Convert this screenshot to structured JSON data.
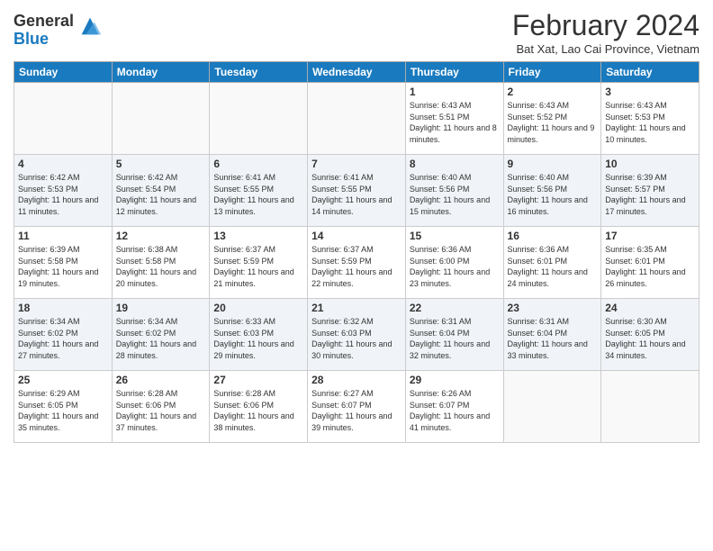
{
  "header": {
    "logo_general": "General",
    "logo_blue": "Blue",
    "title": "February 2024",
    "location": "Bat Xat, Lao Cai Province, Vietnam"
  },
  "days_of_week": [
    "Sunday",
    "Monday",
    "Tuesday",
    "Wednesday",
    "Thursday",
    "Friday",
    "Saturday"
  ],
  "weeks": [
    [
      {
        "day": "",
        "info": ""
      },
      {
        "day": "",
        "info": ""
      },
      {
        "day": "",
        "info": ""
      },
      {
        "day": "",
        "info": ""
      },
      {
        "day": "1",
        "info": "Sunrise: 6:43 AM\nSunset: 5:51 PM\nDaylight: 11 hours and 8 minutes."
      },
      {
        "day": "2",
        "info": "Sunrise: 6:43 AM\nSunset: 5:52 PM\nDaylight: 11 hours and 9 minutes."
      },
      {
        "day": "3",
        "info": "Sunrise: 6:43 AM\nSunset: 5:53 PM\nDaylight: 11 hours and 10 minutes."
      }
    ],
    [
      {
        "day": "4",
        "info": "Sunrise: 6:42 AM\nSunset: 5:53 PM\nDaylight: 11 hours and 11 minutes."
      },
      {
        "day": "5",
        "info": "Sunrise: 6:42 AM\nSunset: 5:54 PM\nDaylight: 11 hours and 12 minutes."
      },
      {
        "day": "6",
        "info": "Sunrise: 6:41 AM\nSunset: 5:55 PM\nDaylight: 11 hours and 13 minutes."
      },
      {
        "day": "7",
        "info": "Sunrise: 6:41 AM\nSunset: 5:55 PM\nDaylight: 11 hours and 14 minutes."
      },
      {
        "day": "8",
        "info": "Sunrise: 6:40 AM\nSunset: 5:56 PM\nDaylight: 11 hours and 15 minutes."
      },
      {
        "day": "9",
        "info": "Sunrise: 6:40 AM\nSunset: 5:56 PM\nDaylight: 11 hours and 16 minutes."
      },
      {
        "day": "10",
        "info": "Sunrise: 6:39 AM\nSunset: 5:57 PM\nDaylight: 11 hours and 17 minutes."
      }
    ],
    [
      {
        "day": "11",
        "info": "Sunrise: 6:39 AM\nSunset: 5:58 PM\nDaylight: 11 hours and 19 minutes."
      },
      {
        "day": "12",
        "info": "Sunrise: 6:38 AM\nSunset: 5:58 PM\nDaylight: 11 hours and 20 minutes."
      },
      {
        "day": "13",
        "info": "Sunrise: 6:37 AM\nSunset: 5:59 PM\nDaylight: 11 hours and 21 minutes."
      },
      {
        "day": "14",
        "info": "Sunrise: 6:37 AM\nSunset: 5:59 PM\nDaylight: 11 hours and 22 minutes."
      },
      {
        "day": "15",
        "info": "Sunrise: 6:36 AM\nSunset: 6:00 PM\nDaylight: 11 hours and 23 minutes."
      },
      {
        "day": "16",
        "info": "Sunrise: 6:36 AM\nSunset: 6:01 PM\nDaylight: 11 hours and 24 minutes."
      },
      {
        "day": "17",
        "info": "Sunrise: 6:35 AM\nSunset: 6:01 PM\nDaylight: 11 hours and 26 minutes."
      }
    ],
    [
      {
        "day": "18",
        "info": "Sunrise: 6:34 AM\nSunset: 6:02 PM\nDaylight: 11 hours and 27 minutes."
      },
      {
        "day": "19",
        "info": "Sunrise: 6:34 AM\nSunset: 6:02 PM\nDaylight: 11 hours and 28 minutes."
      },
      {
        "day": "20",
        "info": "Sunrise: 6:33 AM\nSunset: 6:03 PM\nDaylight: 11 hours and 29 minutes."
      },
      {
        "day": "21",
        "info": "Sunrise: 6:32 AM\nSunset: 6:03 PM\nDaylight: 11 hours and 30 minutes."
      },
      {
        "day": "22",
        "info": "Sunrise: 6:31 AM\nSunset: 6:04 PM\nDaylight: 11 hours and 32 minutes."
      },
      {
        "day": "23",
        "info": "Sunrise: 6:31 AM\nSunset: 6:04 PM\nDaylight: 11 hours and 33 minutes."
      },
      {
        "day": "24",
        "info": "Sunrise: 6:30 AM\nSunset: 6:05 PM\nDaylight: 11 hours and 34 minutes."
      }
    ],
    [
      {
        "day": "25",
        "info": "Sunrise: 6:29 AM\nSunset: 6:05 PM\nDaylight: 11 hours and 35 minutes."
      },
      {
        "day": "26",
        "info": "Sunrise: 6:28 AM\nSunset: 6:06 PM\nDaylight: 11 hours and 37 minutes."
      },
      {
        "day": "27",
        "info": "Sunrise: 6:28 AM\nSunset: 6:06 PM\nDaylight: 11 hours and 38 minutes."
      },
      {
        "day": "28",
        "info": "Sunrise: 6:27 AM\nSunset: 6:07 PM\nDaylight: 11 hours and 39 minutes."
      },
      {
        "day": "29",
        "info": "Sunrise: 6:26 AM\nSunset: 6:07 PM\nDaylight: 11 hours and 41 minutes."
      },
      {
        "day": "",
        "info": ""
      },
      {
        "day": "",
        "info": ""
      }
    ]
  ]
}
